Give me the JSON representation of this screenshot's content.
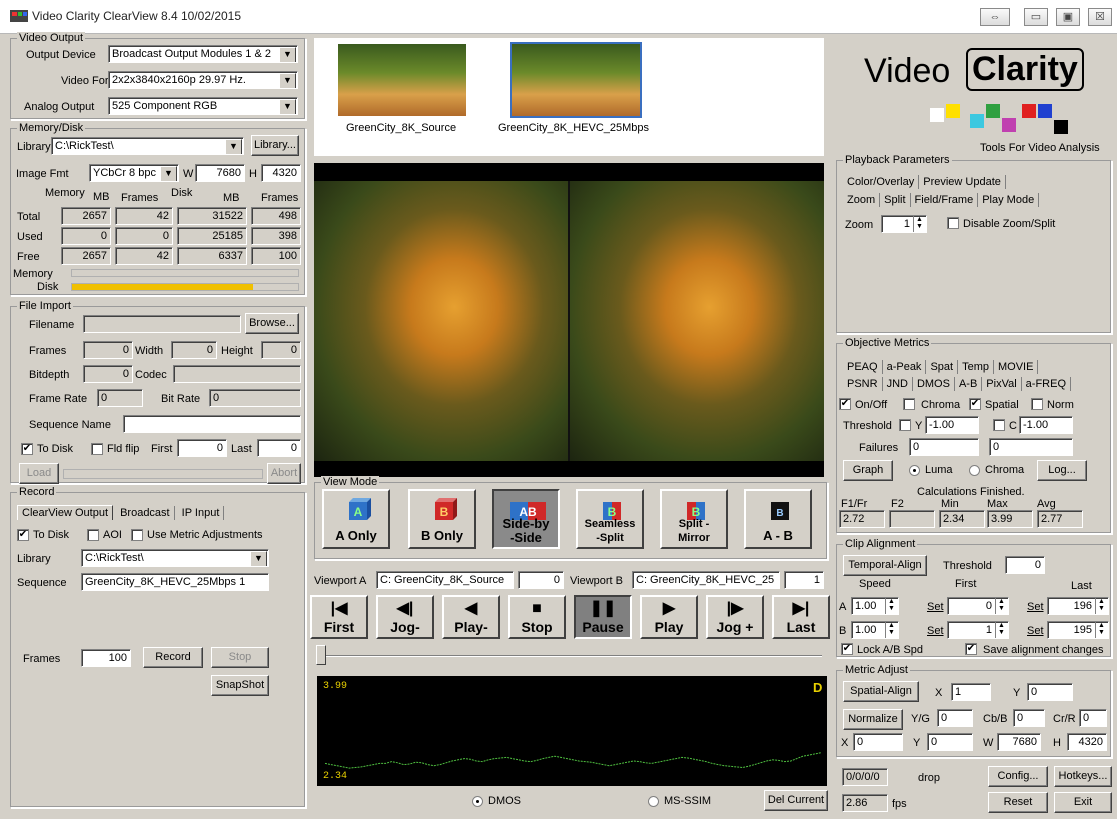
{
  "window": {
    "title": "Video Clarity ClearView 8.4 10/02/2015",
    "restore_glyph": "⇔",
    "minimize_glyph": "▭",
    "maximize_glyph": "▣",
    "close_glyph": "☒"
  },
  "video_output": {
    "legend": "Video Output",
    "device_label": "Output Device",
    "device_value": "Broadcast Output Modules 1 & 2",
    "format_label": "Video Format",
    "format_value": "2x2x3840x2160p 29.97 Hz.",
    "analog_label": "Analog Output",
    "analog_value": "525 Component RGB"
  },
  "memory_disk": {
    "legend": "Memory/Disk",
    "library_label": "Library",
    "library_value": "C:\\RickTest\\",
    "library_button": "Library...",
    "image_fmt_label": "Image Fmt",
    "image_fmt_value": "YCbCr 8 bpc",
    "w_label": "W",
    "w_value": "7680",
    "h_label": "H",
    "h_value": "4320",
    "hdr_memory": "Memory",
    "hdr_mb1": "MB",
    "hdr_frames1": "Frames",
    "hdr_disk": "Disk",
    "hdr_mb2": "MB",
    "hdr_frames2": "Frames",
    "rows": [
      {
        "label": "Total",
        "mem_mb": "2657",
        "mem_frames": "42",
        "disk_mb": "31522",
        "disk_frames": "498"
      },
      {
        "label": "Used",
        "mem_mb": "0",
        "mem_frames": "0",
        "disk_mb": "25185",
        "disk_frames": "398"
      },
      {
        "label": "Free",
        "mem_mb": "2657",
        "mem_frames": "42",
        "disk_mb": "6337",
        "disk_frames": "100"
      }
    ],
    "memory_bar_label": "Memory",
    "disk_bar_label": "Disk",
    "memory_fill": 0.0,
    "disk_fill": 0.8,
    "disk_bar_color": "#f0c000"
  },
  "file_import": {
    "legend": "File Import",
    "filename_label": "Filename",
    "filename_value": "",
    "browse_button": "Browse...",
    "frames_label": "Frames",
    "frames_value": "0",
    "width_label": "Width",
    "width_value": "0",
    "height_label": "Height",
    "height_value": "0",
    "bitdepth_label": "Bitdepth",
    "bitdepth_value": "0",
    "codec_label": "Codec",
    "codec_value": "",
    "framerate_label": "Frame Rate",
    "framerate_value": "0",
    "bitrate_label": "Bit Rate",
    "bitrate_value": "0",
    "seqname_label": "Sequence Name",
    "seqname_value": "",
    "todisk_label": "To Disk",
    "fldflip_label": "Fld flip",
    "first_label": "First",
    "first_value": "0",
    "last_label": "Last",
    "last_value": "0",
    "load_button": "Load",
    "abort_button": "Abort"
  },
  "record": {
    "legend": "Record",
    "tabs": [
      "ClearView Output",
      "Broadcast",
      "IP Input"
    ],
    "todisk_label": "To Disk",
    "aoi_label": "AOI",
    "metric_label": "Use Metric Adjustments",
    "library_label": "Library",
    "library_value": "C:\\RickTest\\",
    "sequence_label": "Sequence",
    "sequence_value": "GreenCity_8K_HEVC_25Mbps 1",
    "frames_label": "Frames",
    "frames_value": "100",
    "record_button": "Record",
    "stop_button": "Stop",
    "snapshot_button": "SnapShot"
  },
  "thumbnails": [
    {
      "caption": "GreenCity_8K_Source"
    },
    {
      "caption": "GreenCity_8K_HEVC_25Mbps"
    }
  ],
  "logo": {
    "word1": "Video",
    "word2": "Clarity",
    "tagline": "Tools For Video Analysis"
  },
  "playback": {
    "legend": "Playback Parameters",
    "tabs_row1": [
      "Color/Overlay",
      "Preview Update"
    ],
    "tabs_row2": [
      "Zoom",
      "Split",
      "Field/Frame",
      "Play Mode"
    ],
    "zoom_label": "Zoom",
    "zoom_value": "1",
    "disable_label": "Disable Zoom/Split"
  },
  "view_mode": {
    "legend": "View Mode",
    "buttons": [
      {
        "label": "A Only",
        "glyph": "A"
      },
      {
        "label": "B Only",
        "glyph": "B"
      },
      {
        "label": "Side-by\n-Side",
        "glyph": "AB"
      },
      {
        "label": "Seamless\n-Split",
        "glyph": "B"
      },
      {
        "label": "Split -\nMirror",
        "glyph": "B"
      },
      {
        "label": "A - B",
        "glyph": "B"
      }
    ]
  },
  "viewports": {
    "a_label": "Viewport A",
    "a_value": "C: GreenCity_8K_Source",
    "a_frame": "0",
    "b_label": "Viewport B",
    "b_value": "C: GreenCity_8K_HEVC_25",
    "b_frame": "1"
  },
  "transport": [
    {
      "label": "First",
      "glyph": "|◀"
    },
    {
      "label": "Jog-",
      "glyph": "◀|"
    },
    {
      "label": "Play-",
      "glyph": "◀"
    },
    {
      "label": "Stop",
      "glyph": "■"
    },
    {
      "label": "Pause",
      "glyph": "❚❚"
    },
    {
      "label": "Play",
      "glyph": "▶"
    },
    {
      "label": "Jog +",
      "glyph": "|▶"
    },
    {
      "label": "Last",
      "glyph": "▶|"
    }
  ],
  "graph": {
    "ymax": "3.99",
    "ymin": "2.34",
    "tag": "D",
    "dmos_label": "DMOS",
    "msssim_label": "MS-SSIM",
    "del_button": "Del Current",
    "series": [
      2.62,
      2.6,
      2.58,
      2.56,
      2.54,
      2.55,
      2.56,
      2.58,
      2.6,
      2.62,
      2.62,
      2.65,
      2.63,
      2.6,
      2.61,
      2.64,
      2.63,
      2.6,
      2.58,
      2.6,
      2.63,
      2.66,
      2.68,
      2.7,
      2.69,
      2.66,
      2.65,
      2.68,
      2.7,
      2.71,
      2.72,
      2.7,
      2.68,
      2.66,
      2.65,
      2.67,
      2.7,
      2.72,
      2.74,
      2.72,
      2.7,
      2.68,
      2.66,
      2.65,
      2.64,
      2.62,
      2.6,
      2.58,
      2.6,
      2.62,
      2.64,
      2.66,
      2.65,
      2.63,
      2.62,
      2.64,
      2.66,
      2.68,
      2.7,
      2.72,
      2.71,
      2.69,
      2.67,
      2.65,
      2.62,
      2.6,
      2.58,
      2.57,
      2.56,
      2.55,
      2.57,
      2.6,
      2.63,
      2.66,
      2.68,
      2.67,
      2.65,
      2.66,
      2.7,
      2.74,
      2.76,
      2.78,
      2.8
    ]
  },
  "objective_metrics": {
    "legend": "Objective Metrics",
    "tabs_row1": [
      "PEAQ",
      "a-Peak",
      "Spat",
      "Temp",
      "MOVIE"
    ],
    "tabs_row2": [
      "PSNR",
      "JND",
      "DMOS",
      "A-B",
      "PixVal",
      "a-FREQ"
    ],
    "onoff_label": "On/Off",
    "chroma_label": "Chroma",
    "spatial_label": "Spatial",
    "norm_label": "Norm",
    "threshold_label": "Threshold",
    "y_label": "Y",
    "y_value": "-1.00",
    "c_label": "C",
    "c_value": "-1.00",
    "failures_label": "Failures",
    "failures_a": "0",
    "failures_b": "0",
    "graph_button": "Graph",
    "luma_label": "Luma",
    "chroma2_label": "Chroma",
    "log_button": "Log...",
    "calc_status": "Calculations Finished.",
    "f1_label": "F1/Fr",
    "f2_label": "F2",
    "min_label": "Min",
    "max_label": "Max",
    "avg_label": "Avg",
    "f1_value": "2.72",
    "f2_value": "",
    "min_value": "2.34",
    "max_value": "3.99",
    "avg_value": "2.77"
  },
  "clip_alignment": {
    "legend": "Clip Alignment",
    "temporal_button": "Temporal-Align",
    "threshold_label": "Threshold",
    "threshold_value": "0",
    "speed_label": "Speed",
    "first_label": "First",
    "last_label": "Last",
    "a_label": "A",
    "b_label": "B",
    "a_speed": "1.00",
    "b_speed": "1.00",
    "set_label": "Set",
    "a_first": "0",
    "b_first": "1",
    "a_last": "196",
    "b_last": "195",
    "lock_label": "Lock A/B Spd",
    "save_label": "Save alignment changes"
  },
  "metric_adjust": {
    "legend": "Metric Adjust",
    "spatial_button": "Spatial-Align",
    "x_label": "X",
    "x_value": "1",
    "y_label": "Y",
    "y_value": "0",
    "normalize_button": "Normalize",
    "yg_label": "Y/G",
    "yg_value": "0",
    "cbb_label": "Cb/B",
    "cbb_value": "0",
    "crr_label": "Cr/R",
    "crr_value": "0",
    "x2_label": "X",
    "x2_value": "0",
    "y2_label": "Y",
    "y2_value": "0",
    "w_label": "W",
    "w_value": "7680",
    "h_label": "H",
    "h_value": "4320"
  },
  "footer": {
    "drop_value": "0/0/0/0",
    "drop_label": "drop",
    "fps_value": "2.86",
    "fps_label": "fps",
    "config_button": "Config...",
    "hotkeys_button": "Hotkeys...",
    "reset_button": "Reset",
    "exit_button": "Exit"
  }
}
